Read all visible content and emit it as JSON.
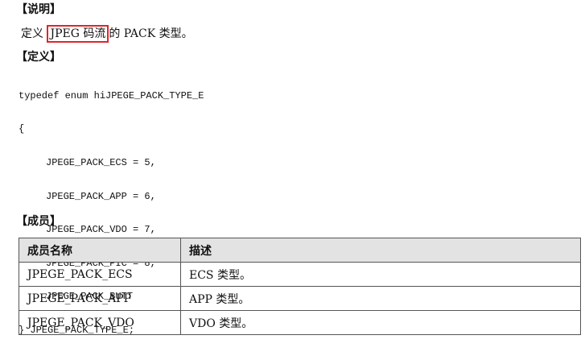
{
  "sections": {
    "description_heading": "【说明】",
    "definition_heading": "【定义】",
    "members_heading": "【成员】"
  },
  "description": {
    "prefix": "定义 ",
    "highlighted": "JPEG 码流",
    "suffix": "的 PACK 类型。",
    "highlight_color": "#e0252b"
  },
  "definition": {
    "lines": [
      "typedef enum hiJPEGE_PACK_TYPE_E",
      "{",
      "JPEGE_PACK_ECS = 5,",
      "JPEGE_PACK_APP = 6,",
      "JPEGE_PACK_VDO = 7,",
      "JPEGE_PACK_PIC = 8,",
      "JPEGE_PACK_BUTT",
      "} JPEGE_PACK_TYPE_E;"
    ]
  },
  "members_table": {
    "headers": [
      "成员名称",
      "描述"
    ],
    "rows": [
      [
        "JPEGE_PACK_ECS",
        "ECS 类型。"
      ],
      [
        "JPEGE_PACK_APP",
        "APP 类型。"
      ],
      [
        "JPEGE_PACK_VDO",
        "VDO 类型。"
      ]
    ],
    "header_bg": "#e3e3e3"
  }
}
